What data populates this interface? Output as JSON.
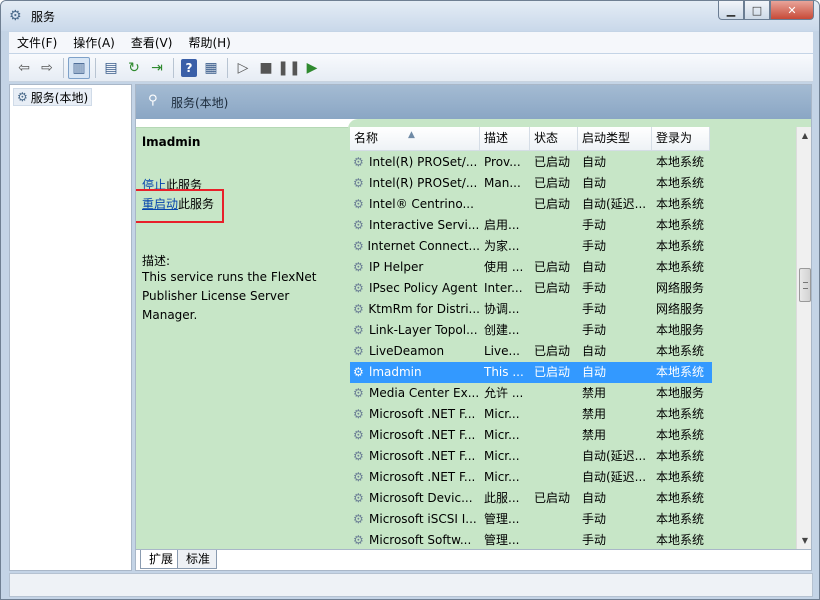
{
  "window": {
    "title": "服务"
  },
  "menu": [
    "文件(F)",
    "操作(A)",
    "查看(V)",
    "帮助(H)"
  ],
  "tree": {
    "root": "服务(本地)"
  },
  "pane": {
    "header": "服务(本地)",
    "selected_service": "lmadmin",
    "stop_link": "停止",
    "stop_suffix": "此服务",
    "restart_link": "重启动",
    "restart_suffix": "此服务",
    "desc_label": "描述:",
    "desc_text": "This service runs the FlexNet Publisher License Server Manager."
  },
  "columns": [
    "名称",
    "描述",
    "状态",
    "启动类型",
    "登录为"
  ],
  "rows": [
    {
      "name": "Intel(R) PROSet/...",
      "desc": "Prov...",
      "status": "已启动",
      "start": "自动",
      "logon": "本地系统"
    },
    {
      "name": "Intel(R) PROSet/...",
      "desc": "Man...",
      "status": "已启动",
      "start": "自动",
      "logon": "本地系统"
    },
    {
      "name": "Intel® Centrino...",
      "desc": "",
      "status": "已启动",
      "start": "自动(延迟...",
      "logon": "本地系统"
    },
    {
      "name": "Interactive Servi...",
      "desc": "启用...",
      "status": "",
      "start": "手动",
      "logon": "本地系统"
    },
    {
      "name": "Internet Connect...",
      "desc": "为家...",
      "status": "",
      "start": "手动",
      "logon": "本地系统"
    },
    {
      "name": "IP Helper",
      "desc": "使用 ...",
      "status": "已启动",
      "start": "自动",
      "logon": "本地系统"
    },
    {
      "name": "IPsec Policy Agent",
      "desc": "Inter...",
      "status": "已启动",
      "start": "手动",
      "logon": "网络服务"
    },
    {
      "name": "KtmRm for Distri...",
      "desc": "协调...",
      "status": "",
      "start": "手动",
      "logon": "网络服务"
    },
    {
      "name": "Link-Layer Topol...",
      "desc": "创建...",
      "status": "",
      "start": "手动",
      "logon": "本地服务"
    },
    {
      "name": "LiveDeamon",
      "desc": "Live...",
      "status": "已启动",
      "start": "自动",
      "logon": "本地系统"
    },
    {
      "name": "lmadmin",
      "desc": "This ...",
      "status": "已启动",
      "start": "自动",
      "logon": "本地系统",
      "selected": true
    },
    {
      "name": "Media Center Ex...",
      "desc": "允许 ...",
      "status": "",
      "start": "禁用",
      "logon": "本地服务"
    },
    {
      "name": "Microsoft .NET F...",
      "desc": "Micr...",
      "status": "",
      "start": "禁用",
      "logon": "本地系统"
    },
    {
      "name": "Microsoft .NET F...",
      "desc": "Micr...",
      "status": "",
      "start": "禁用",
      "logon": "本地系统"
    },
    {
      "name": "Microsoft .NET F...",
      "desc": "Micr...",
      "status": "",
      "start": "自动(延迟...",
      "logon": "本地系统"
    },
    {
      "name": "Microsoft .NET F...",
      "desc": "Micr...",
      "status": "",
      "start": "自动(延迟...",
      "logon": "本地系统"
    },
    {
      "name": "Microsoft Devic...",
      "desc": "此服...",
      "status": "已启动",
      "start": "自动",
      "logon": "本地系统"
    },
    {
      "name": "Microsoft iSCSI I...",
      "desc": "管理...",
      "status": "",
      "start": "手动",
      "logon": "本地系统"
    },
    {
      "name": "Microsoft Softw...",
      "desc": "管理...",
      "status": "",
      "start": "手动",
      "logon": "本地系统"
    }
  ],
  "tabs": [
    "扩展",
    "标准"
  ],
  "icons": {
    "title": "gear-icon",
    "toolbar": [
      "back-arrow-icon",
      "forward-arrow-icon",
      "console-tree-icon",
      "properties-icon",
      "refresh-icon",
      "export-list-icon",
      "help-icon",
      "show-action-pane-icon",
      "play-icon",
      "stop-icon",
      "pause-icon",
      "resume-icon"
    ]
  },
  "colors": {
    "highlight": "#3399ff",
    "pane_bg": "#c7e6c7",
    "header_bg": "#8aa6c4",
    "callout": "#e8202a"
  }
}
